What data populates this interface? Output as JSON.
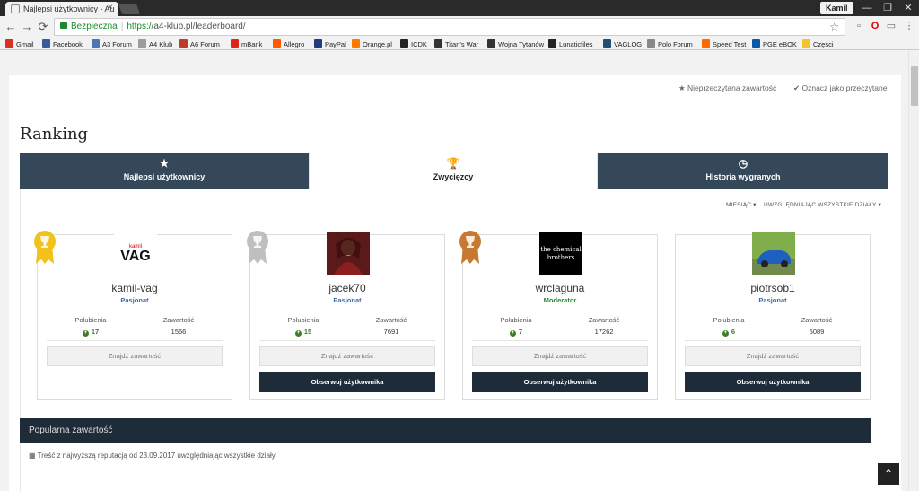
{
  "browser": {
    "tab_title": "Najlepsi użytkownicy - Au",
    "tab_close": "×",
    "user_name": "Kamil",
    "win_min": "—",
    "win_restore": "❐",
    "win_close": "✕",
    "back": "←",
    "forward": "→",
    "reload": "⟳",
    "secure_label": "Bezpieczna",
    "url_sep": "|",
    "url_scheme": "https://",
    "url_rest": "a4-klub.pl/leaderboard/",
    "star": "☆",
    "menu": "⋮"
  },
  "bookmarks": [
    {
      "label": "Gmail",
      "color": "#d93025"
    },
    {
      "label": "Facebook",
      "color": "#3b5998"
    },
    {
      "label": "A3 Forum",
      "color": "#4a78b5"
    },
    {
      "label": "A4 Klub",
      "color": "#9c9c9c"
    },
    {
      "label": "A6 Forum",
      "color": "#c0392b"
    },
    {
      "label": "mBank",
      "color": "#e2231a"
    },
    {
      "label": "Allegro",
      "color": "#ff5a00"
    },
    {
      "label": "PayPal",
      "color": "#253b80"
    },
    {
      "label": "Orange.pl",
      "color": "#ff7900"
    },
    {
      "label": "ICDK",
      "color": "#222222"
    },
    {
      "label": "Titan's War",
      "color": "#333333"
    },
    {
      "label": "Wojna Tytanów",
      "color": "#333333"
    },
    {
      "label": "Lunaticfiles",
      "color": "#222222"
    },
    {
      "label": "VAGLOG",
      "color": "#1f4e79"
    },
    {
      "label": "Polo Forum",
      "color": "#888888"
    },
    {
      "label": "Speed Test",
      "color": "#ff6a00"
    },
    {
      "label": "PGE eBOK",
      "color": "#0a5aa8"
    },
    {
      "label": "Części",
      "color": "#f4c430"
    }
  ],
  "page": {
    "top_actions": {
      "unread": "Nieprzeczytana zawartość",
      "mark_read": "Oznacz jako przeczytane"
    },
    "title": "Ranking",
    "tabs": [
      {
        "label": "Najlepsi użytkownicy",
        "icon": "★",
        "active": false
      },
      {
        "label": "Zwycięzcy",
        "icon": "🏆",
        "active": true
      },
      {
        "label": "Historia wygranych",
        "icon": "◷",
        "active": false
      }
    ],
    "filters": {
      "period": "MIESIĄC",
      "scope": "UWZGLĘDNIAJĄC WSZYSTKIE DZIAŁY"
    },
    "stat_labels": {
      "likes": "Polubienia",
      "content": "Zawartość"
    },
    "find_label": "Znajdź zawartość",
    "follow_label": "Obserwuj użytkownika",
    "users": [
      {
        "name": "kamil-vag",
        "role": "Pasjonat",
        "role_color": "#3d6aa8",
        "likes": "17",
        "content": "1566",
        "medal": "#f2c21b",
        "avatar": "kamil-vag-logo"
      },
      {
        "name": "jacek70",
        "role": "Pasjonat",
        "role_color": "#3d6aa8",
        "likes": "15",
        "content": "7691",
        "medal": "#bfbfbf",
        "avatar": "jacek70-photo"
      },
      {
        "name": "wrclaguna",
        "role": "Moderator",
        "role_color": "#2f8a2f",
        "likes": "7",
        "content": "17262",
        "medal": "#c77a2f",
        "avatar": "wrclaguna-logo"
      },
      {
        "name": "piotrsob1",
        "role": "Pasjonat",
        "role_color": "#3d6aa8",
        "likes": "6",
        "content": "5089",
        "medal": null,
        "avatar": "piotrsob1-car"
      }
    ],
    "popular": {
      "title": "Popularna zawartość",
      "note": "Treść z najwyższą reputacją od 23.09.2017 uwzględniając wszystkie działy"
    },
    "colors": {
      "tab_bg": "#34485a",
      "panel_dark": "#1e2b38"
    }
  }
}
